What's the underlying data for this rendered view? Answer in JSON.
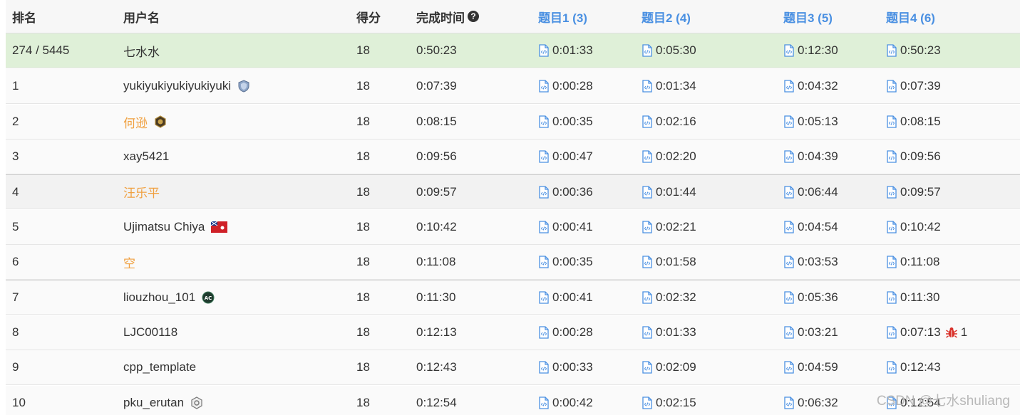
{
  "colors": {
    "self_row_bg": "#dff0d8",
    "problem_link": "#4a90e2",
    "highlight_name": "#f0a040",
    "text": "#333333"
  },
  "header": {
    "rank": "排名",
    "user": "用户名",
    "score": "得分",
    "time": "完成时间",
    "help_icon": "question-circle-icon",
    "q1": "题目1 (3)",
    "q2": "题目2 (4)",
    "q3": "题目3 (5)",
    "q4": "题目4 (6)"
  },
  "rows": [
    {
      "rank": "274 / 5445",
      "user": "七水水",
      "score": "18",
      "time": "0:50:23",
      "q1": "0:01:33",
      "q2": "0:05:30",
      "q3": "0:12:30",
      "q4": "0:50:23"
    },
    {
      "rank": "1",
      "user": "yukiyukiyukiyukiyuki",
      "badge": "shield-badge-icon",
      "score": "18",
      "time": "0:07:39",
      "q1": "0:00:28",
      "q2": "0:01:34",
      "q3": "0:04:32",
      "q4": "0:07:39"
    },
    {
      "rank": "2",
      "user": "何逊",
      "badge": "hexagon-badge-icon",
      "score": "18",
      "time": "0:08:15",
      "q1": "0:00:35",
      "q2": "0:02:16",
      "q3": "0:05:13",
      "q4": "0:08:15"
    },
    {
      "rank": "3",
      "user": "xay5421",
      "score": "18",
      "time": "0:09:56",
      "q1": "0:00:47",
      "q2": "0:02:20",
      "q3": "0:04:39",
      "q4": "0:09:56"
    },
    {
      "rank": "4",
      "user": "汪乐平",
      "score": "18",
      "time": "0:09:57",
      "q1": "0:00:36",
      "q2": "0:01:44",
      "q3": "0:06:44",
      "q4": "0:09:57"
    },
    {
      "rank": "5",
      "user": "Ujimatsu Chiya",
      "badge": "flag-icon",
      "score": "18",
      "time": "0:10:42",
      "q1": "0:00:41",
      "q2": "0:02:21",
      "q3": "0:04:54",
      "q4": "0:10:42"
    },
    {
      "rank": "6",
      "user": "空",
      "score": "18",
      "time": "0:11:08",
      "q1": "0:00:35",
      "q2": "0:01:58",
      "q3": "0:03:53",
      "q4": "0:11:08"
    },
    {
      "rank": "7",
      "user": "liouzhou_101",
      "badge": "ac-badge-icon",
      "score": "18",
      "time": "0:11:30",
      "q1": "0:00:41",
      "q2": "0:02:32",
      "q3": "0:05:36",
      "q4": "0:11:30"
    },
    {
      "rank": "8",
      "user": "LJC00118",
      "score": "18",
      "time": "0:12:13",
      "q1": "0:00:28",
      "q2": "0:01:33",
      "q3": "0:03:21",
      "q4": "0:07:13",
      "q4_bugs": "1"
    },
    {
      "rank": "9",
      "user": "cpp_template",
      "score": "18",
      "time": "0:12:43",
      "q1": "0:00:33",
      "q2": "0:02:09",
      "q3": "0:04:59",
      "q4": "0:12:43"
    },
    {
      "rank": "10",
      "user": "pku_erutan",
      "badge": "gear-badge-icon",
      "score": "18",
      "time": "0:12:54",
      "q1": "0:00:42",
      "q2": "0:02:15",
      "q3": "0:06:32",
      "q4": "0:12:54"
    }
  ],
  "watermark": "CSDN @七水shuliang"
}
